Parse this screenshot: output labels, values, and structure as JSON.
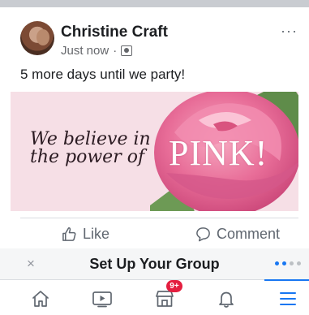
{
  "post": {
    "author": "Christine Craft",
    "timestamp": "Just now",
    "separator": "·",
    "audience_icon": "group-icon",
    "more_label": "···",
    "text": "5 more days until we party!",
    "banner": {
      "slogan_line1": "We believe in",
      "slogan_line2": "the power of",
      "highlight": "PINK!"
    }
  },
  "actions": {
    "like_label": "Like",
    "comment_label": "Comment"
  },
  "group_bar": {
    "close_label": "×",
    "title": "Set Up Your Group",
    "progress": 0.5
  },
  "tabbar": {
    "items": [
      {
        "name": "home",
        "icon": "home-icon"
      },
      {
        "name": "watch",
        "icon": "video-icon"
      },
      {
        "name": "marketplace",
        "icon": "marketplace-icon",
        "badge": "9+"
      },
      {
        "name": "notifications",
        "icon": "bell-icon"
      },
      {
        "name": "menu",
        "icon": "menu-icon",
        "active": true
      }
    ]
  },
  "colors": {
    "accent": "#1877f2",
    "badge": "#e41e3f",
    "banner_bg": "#f6dfe6"
  }
}
